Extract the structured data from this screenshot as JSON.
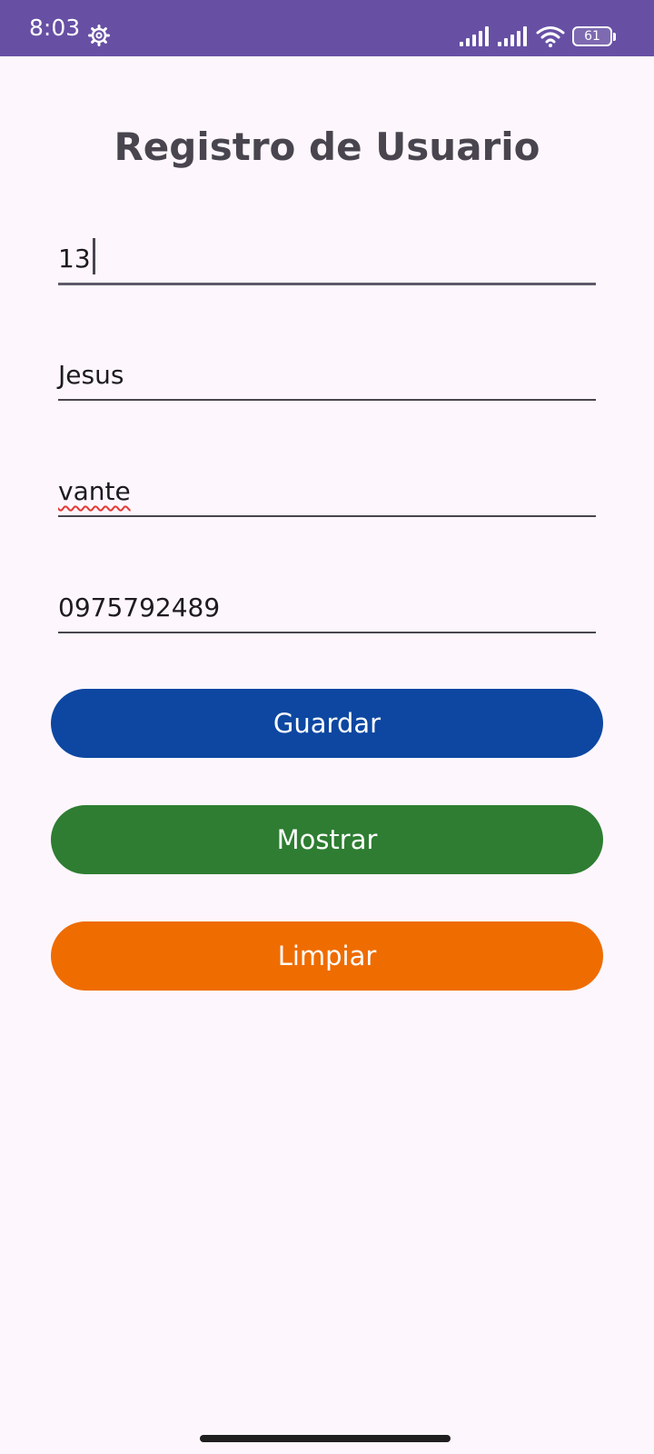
{
  "status_bar": {
    "time": "8:03",
    "battery": "61",
    "icons": [
      "gear-icon",
      "signal-icon",
      "signal-icon",
      "wifi-icon",
      "battery-icon"
    ]
  },
  "title": "Registro de Usuario",
  "fields": {
    "id": "13",
    "first_name": "Jesus",
    "last_name": "vante",
    "phone": "0975792489"
  },
  "buttons": {
    "save": "Guardar",
    "show": "Mostrar",
    "clear": "Limpiar"
  },
  "colors": {
    "status_bar": "#6750a4",
    "background": "#fdf6fd",
    "save_button": "#0d47a1",
    "show_button": "#2e7d32",
    "clear_button": "#ef6c00"
  }
}
